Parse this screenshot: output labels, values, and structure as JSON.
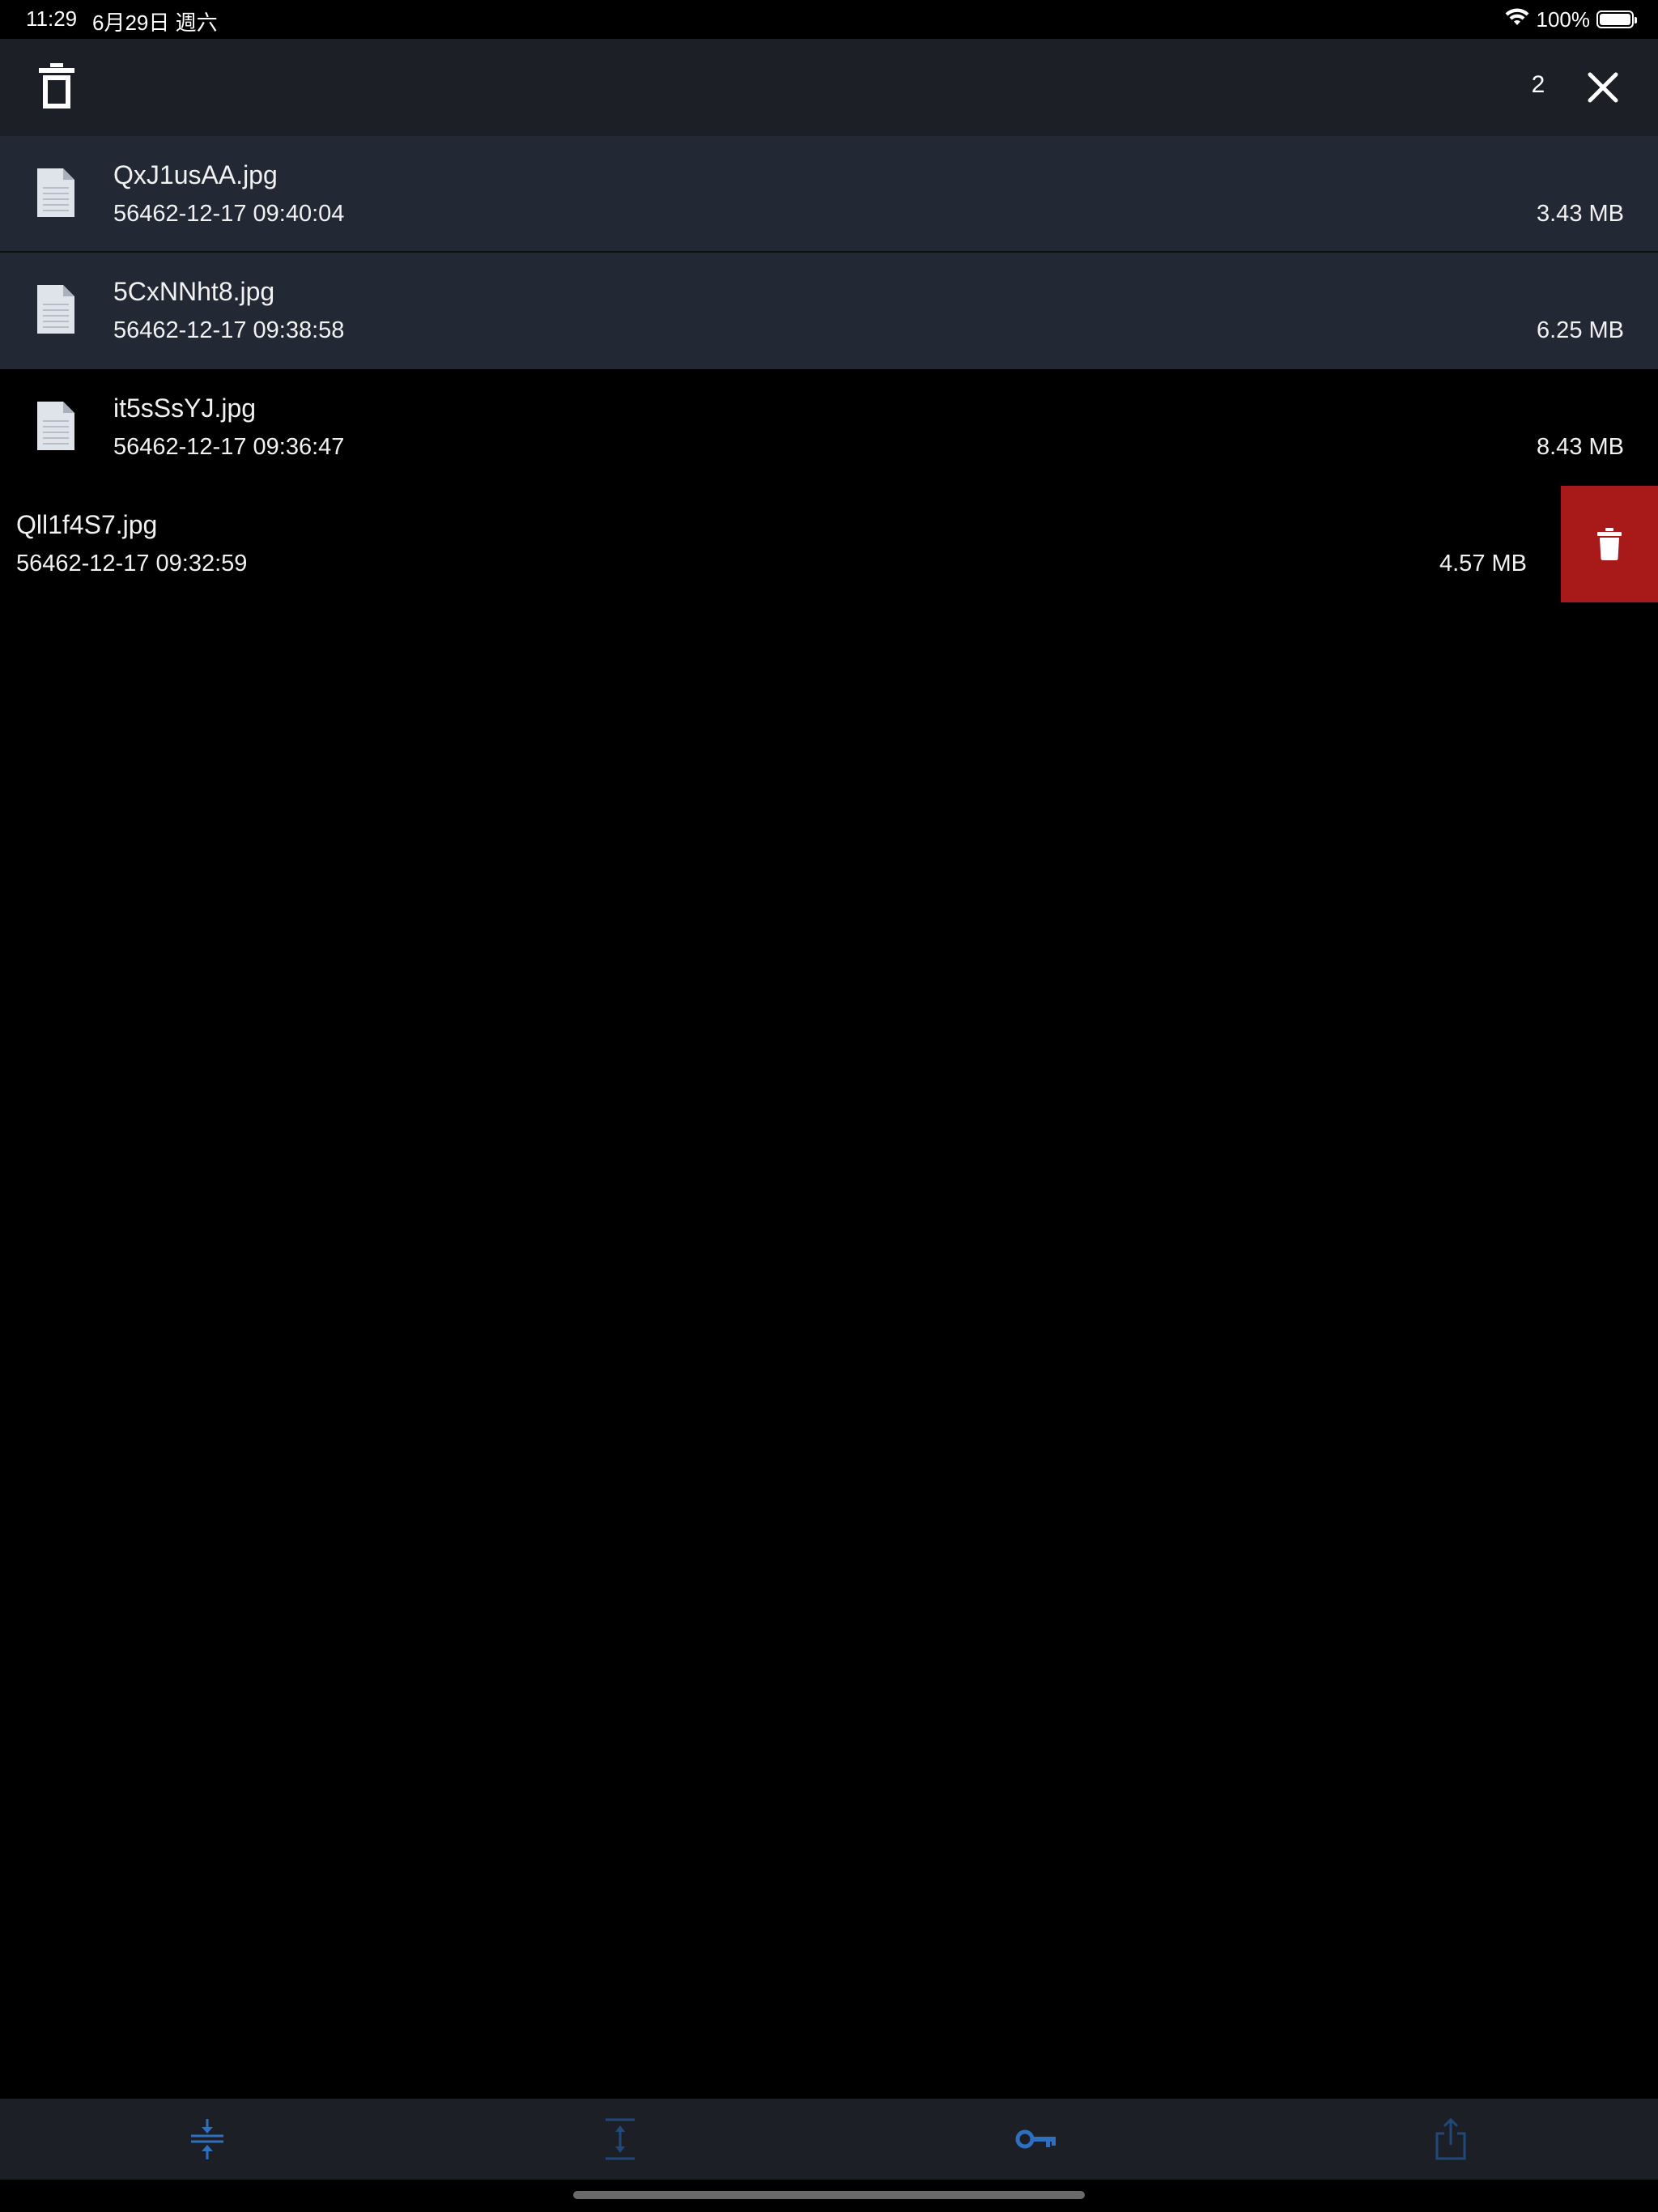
{
  "status_bar": {
    "time": "11:29",
    "date": "6月29日 週六",
    "battery": "100%"
  },
  "toolbar": {
    "selected_count": "2"
  },
  "files": [
    {
      "name": "QxJ1usAA.jpg",
      "date": "56462-12-17 09:40:04",
      "size": "3.43 MB"
    },
    {
      "name": "5CxNNht8.jpg",
      "date": "56462-12-17 09:38:58",
      "size": "6.25 MB"
    },
    {
      "name": "it5sSsYJ.jpg",
      "date": "56462-12-17 09:36:47",
      "size": "8.43 MB"
    },
    {
      "name": "Qll1f4S7.jpg",
      "date": "56462-12-17 09:32:59",
      "size": "4.57 MB"
    }
  ],
  "bottom_bar": {
    "icons": [
      "compress-icon",
      "expand-icon",
      "key-icon",
      "share-icon"
    ]
  },
  "colors": {
    "accent": "#2f6fc0",
    "accent_dim": "#22487a",
    "delete_red": "#a8191a",
    "toolbar_bg": "#1c1f25",
    "selected_row_bg": "#232934"
  }
}
